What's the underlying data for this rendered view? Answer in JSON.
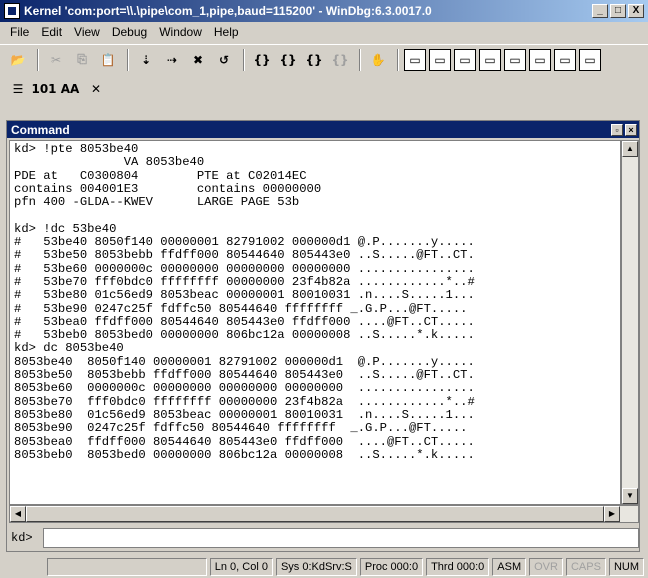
{
  "window": {
    "title": "Kernel 'com:port=\\\\.\\pipe\\com_1,pipe,baud=115200' - WinDbg:6.3.0017.0",
    "min_label": "_",
    "max_label": "□",
    "close_label": "X"
  },
  "menu": [
    "File",
    "Edit",
    "View",
    "Debug",
    "Window",
    "Help"
  ],
  "toolbar1": [
    {
      "name": "open-icon",
      "glyph": "📂"
    },
    {
      "sep": true
    },
    {
      "name": "cut-icon",
      "glyph": "✂",
      "dim": true
    },
    {
      "name": "copy-icon",
      "glyph": "⎘",
      "dim": true
    },
    {
      "name": "paste-icon",
      "glyph": "📋"
    },
    {
      "sep": true
    },
    {
      "name": "step-into-icon",
      "glyph": "⇣"
    },
    {
      "name": "step-over-icon",
      "glyph": "⇢"
    },
    {
      "name": "break-icon",
      "glyph": "✖"
    },
    {
      "name": "restart-icon",
      "glyph": "↺"
    },
    {
      "sep": true
    },
    {
      "name": "step-in-source-icon",
      "glyph": "{}"
    },
    {
      "name": "step-over-source-icon",
      "glyph": "{}"
    },
    {
      "name": "step-out-icon",
      "glyph": "{}"
    },
    {
      "name": "run-to-cursor-icon",
      "glyph": "{}",
      "dim": true
    },
    {
      "sep": true
    },
    {
      "name": "hand-icon",
      "glyph": "✋"
    },
    {
      "sep": true
    },
    {
      "name": "command-window-icon",
      "glyph": "▭",
      "boxed": true
    },
    {
      "name": "watch-window-icon",
      "glyph": "▭",
      "boxed": true
    },
    {
      "name": "locals-window-icon",
      "glyph": "▭",
      "boxed": true
    },
    {
      "name": "registers-window-icon",
      "glyph": "▭",
      "boxed": true
    },
    {
      "name": "memory-window-icon",
      "glyph": "▭",
      "boxed": true
    },
    {
      "name": "callstack-window-icon",
      "glyph": "▭",
      "boxed": true
    },
    {
      "name": "disassembly-window-icon",
      "glyph": "▭",
      "boxed": true
    },
    {
      "name": "scratch-window-icon",
      "glyph": "▭",
      "boxed": true
    }
  ],
  "toolbar2": [
    {
      "name": "source-mode-icon",
      "glyph": "☰"
    },
    {
      "name": "hex-mode-icon",
      "glyph": "101"
    },
    {
      "name": "font-icon",
      "glyph": "AA"
    },
    {
      "name": "options-icon",
      "glyph": "✕"
    }
  ],
  "command_window": {
    "title": "Command",
    "restore_label": "▫",
    "close_label": "×",
    "output": [
      "kd> !pte 8053be40",
      "               VA 8053be40",
      "PDE at   C0300804        PTE at C02014EC",
      "contains 004001E3        contains 00000000",
      "pfn 400 -GLDA--KWEV      LARGE PAGE 53b",
      "",
      "kd> !dc 53be40",
      "#   53be40 8050f140 00000001 82791002 000000d1 @.P.......y.....",
      "#   53be50 8053bebb ffdff000 80544640 805443e0 ..S.....@FT..CT.",
      "#   53be60 0000000c 00000000 00000000 00000000 ................",
      "#   53be70 fff0bdc0 ffffffff 00000000 23f4b82a ............*..#",
      "#   53be80 01c56ed9 8053beac 00000001 80010031 .n....S.....1...",
      "#   53be90 0247c25f fdffc50 80544640 ffffffff _.G.P...@FT.....",
      "#   53bea0 ffdff000 80544640 805443e0 ffdff000 ....@FT..CT.....",
      "#   53beb0 8053bed0 00000000 806bc12a 00000008 ..S.....*.k.....",
      "kd> dc 8053be40",
      "8053be40  8050f140 00000001 82791002 000000d1  @.P.......y.....",
      "8053be50  8053bebb ffdff000 80544640 805443e0  ..S.....@FT..CT.",
      "8053be60  0000000c 00000000 00000000 00000000  ................",
      "8053be70  fff0bdc0 ffffffff 00000000 23f4b82a  ............*..#",
      "8053be80  01c56ed9 8053beac 00000001 80010031  .n....S.....1...",
      "8053be90  0247c25f fdffc50 80544640 ffffffff  _.G.P...@FT.....",
      "8053bea0  ffdff000 80544640 805443e0 ffdff000  ....@FT..CT.....",
      "8053beb0  8053bed0 00000000 806bc12a 00000008  ..S.....*.k....."
    ],
    "prompt": "kd>",
    "input_value": ""
  },
  "statusbar": {
    "ln_col": "Ln 0, Col 0",
    "sys": "Sys 0:KdSrv:S",
    "proc": "Proc 000:0",
    "thrd": "Thrd 000:0",
    "asm": "ASM",
    "ovr": "OVR",
    "caps": "CAPS",
    "num": "NUM"
  }
}
